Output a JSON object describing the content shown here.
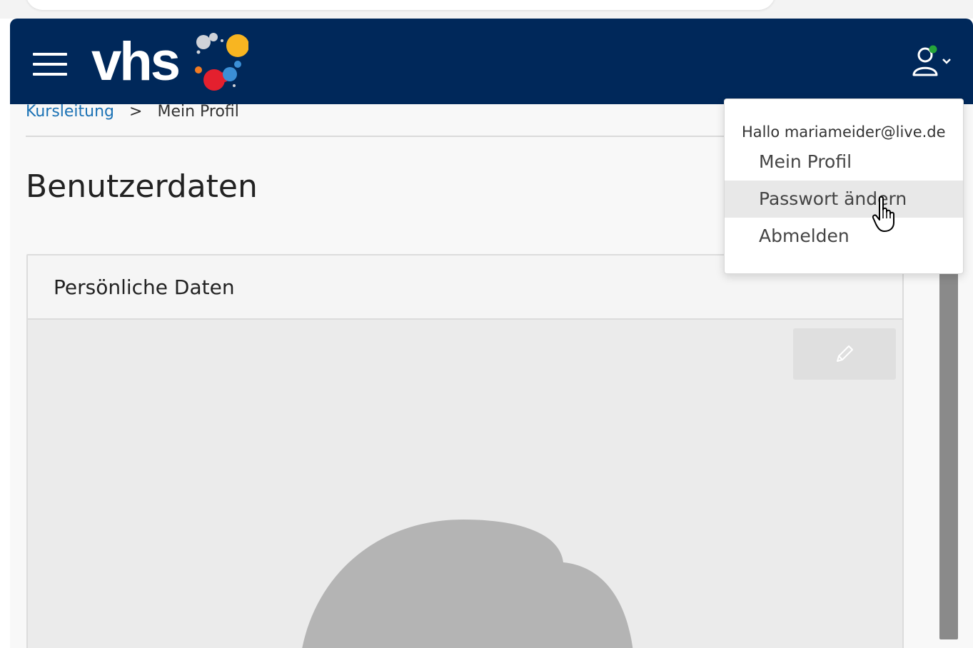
{
  "header": {
    "logo_text": "vhs",
    "colors": {
      "bar": "#00285a",
      "logo_dot_grey": "#cfd2d8",
      "logo_dot_yellow": "#f8b521",
      "logo_dot_orange": "#f27b22",
      "logo_dot_red": "#e4202e",
      "logo_dot_blue": "#3b8fd6",
      "status_green": "#26a53a"
    }
  },
  "breadcrumb": {
    "items": [
      "Kursleitung",
      "Mein Profil"
    ],
    "separator": ">"
  },
  "page": {
    "title": "Benutzerdaten"
  },
  "card": {
    "title": "Persönliche Daten",
    "edit_icon": "pencil-icon"
  },
  "user_menu": {
    "greeting": "Hallo mariameider@live.de",
    "items": [
      {
        "label": "Mein Profil"
      },
      {
        "label": "Passwort ändern",
        "hovered": true
      },
      {
        "label": "Abmelden"
      }
    ]
  }
}
